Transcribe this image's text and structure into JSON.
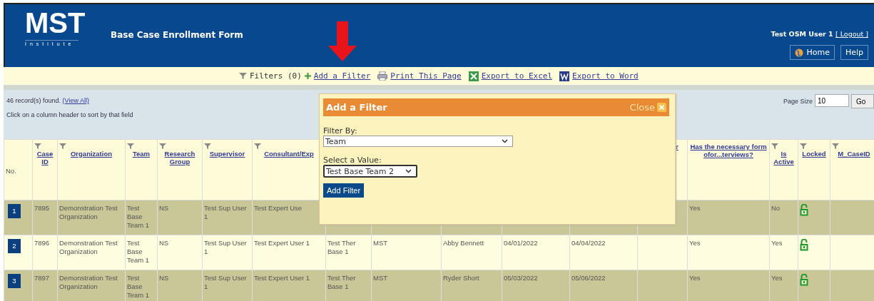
{
  "header": {
    "logo": "MST",
    "logo_sub": "Institute",
    "title": "Base Case Enrollment Form",
    "user": "Test OSM User 1",
    "logout": "[ Logout ]",
    "buttons": [
      "Home",
      "Help"
    ]
  },
  "toolbar": {
    "filters": "Filters (0)",
    "add_filter": "Add a Filter",
    "print": "Print This Page",
    "excel": "Export to Excel",
    "word": "Export to Word"
  },
  "info": {
    "records": "46 record(s) found.",
    "view_all": "(View All)",
    "hint": "Click on a column header to sort by that field",
    "page_size_label": "Page Size",
    "page_size": "10",
    "go": "Go"
  },
  "table": {
    "columns": [
      {
        "label": "No.",
        "sortable": false,
        "filter": false
      },
      {
        "label": "Case ID",
        "sortable": true,
        "filter": true
      },
      {
        "label": "Organization",
        "sortable": true,
        "filter": true
      },
      {
        "label": "Team",
        "sortable": true,
        "filter": true
      },
      {
        "label": "Research Group",
        "sortable": true,
        "filter": true
      },
      {
        "label": "Supervisor",
        "sortable": true,
        "filter": true
      },
      {
        "label": "Consultant/Exp",
        "sortable": true,
        "filter": true
      },
      {},
      {},
      {},
      {},
      {},
      {
        "label": "r",
        "sortable": true,
        "filter": false
      },
      {
        "label": "Has the necessary form ofor...terviews?",
        "sortable": true,
        "filter": false
      },
      {
        "label": "Is Active",
        "sortable": true,
        "filter": true
      },
      {
        "label": "Locked",
        "sortable": true,
        "filter": true
      },
      {
        "label": "M_CaseID",
        "sortable": true,
        "filter": true
      }
    ],
    "rows": [
      {
        "cells": [
          "1",
          "7895",
          "Demonstration Test Organization",
          "Test Base Team 1",
          "NS",
          "Test Sup User 1",
          "Test Expert Use",
          null,
          null,
          null,
          null,
          null,
          null,
          "Yes",
          "No"
        ]
      },
      {
        "cells": [
          "2",
          "7896",
          "Demonstration Test Organization",
          "Test Base Team 1",
          "NS",
          "Test Sup User 1",
          "Test Expert User 1",
          "Test Ther Base 1",
          "MST",
          "Abby Bennett",
          "04/01/2022",
          "04/04/2022",
          null,
          "Yes",
          "Yes"
        ]
      },
      {
        "cells": [
          "3",
          "7897",
          "Demonstration Test Organization",
          "Test Base Team 1",
          "NS",
          "Test Sup User 1",
          "Test Expert User 1",
          "Test Ther Base 1",
          "MST",
          "Ryder Short",
          "05/03/2022",
          "05/06/2022",
          null,
          "Yes",
          "Yes"
        ]
      }
    ]
  },
  "popup": {
    "title": "Add a Filter",
    "close": "Close",
    "filter_by_label": "Filter By:",
    "filter_by": "Team",
    "value_label": "Select a Value:",
    "value": "Test Base Team 2",
    "button": "Add Filter"
  }
}
